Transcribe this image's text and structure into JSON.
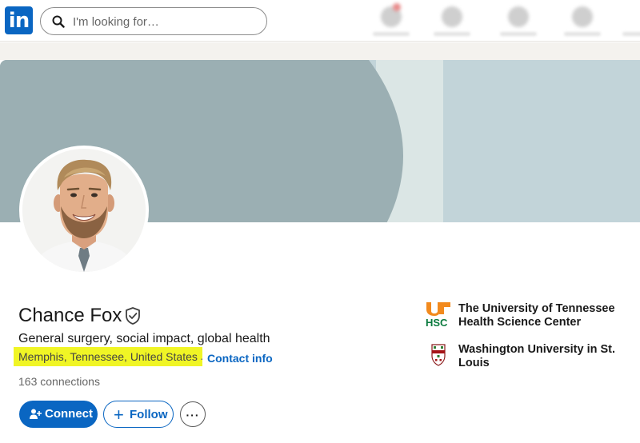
{
  "logo": {
    "text": "in",
    "color": "#0a66c2"
  },
  "search": {
    "placeholder": "I'm looking for…",
    "value": ""
  },
  "profile": {
    "name": "Chance Fox",
    "headline": "General surgery, social impact, global health",
    "location": "Memphis, Tennessee, United States",
    "separator": "·",
    "contact_label": "Contact info",
    "connections": "163 connections",
    "highlight_color": "#f0f525"
  },
  "actions": {
    "connect_label": "Connect",
    "follow_label": "Follow",
    "more_label": "···",
    "follow_plus": "+"
  },
  "education": [
    {
      "name": "The University of Tennessee Health Science Center",
      "logo_text": "UT HSC",
      "logo_icon": "uthsc-logo-icon"
    },
    {
      "name": "Washington University in St. Louis",
      "logo_icon": "washu-crest-icon"
    }
  ],
  "icons": {
    "search": "search-icon",
    "verified": "shield-check-icon",
    "connect": "add-person-icon"
  },
  "colors": {
    "accent": "#0a66c2",
    "cover_dark": "#9bafb3",
    "cover_light": "#c2d4d9",
    "uthsc_orange": "#f28a1e",
    "uthsc_green": "#0a7a3e"
  }
}
